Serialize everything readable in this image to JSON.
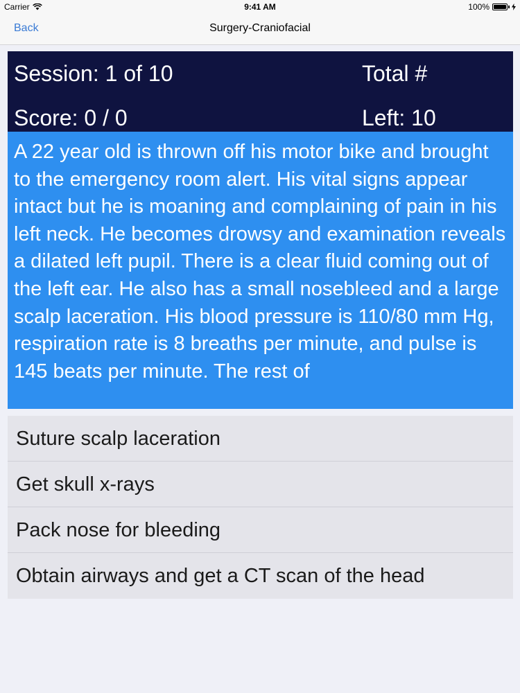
{
  "status_bar": {
    "carrier": "Carrier",
    "time": "9:41 AM",
    "battery": "100%",
    "icons": [
      "wifi-icon",
      "battery-icon",
      "charging-bolt-icon"
    ]
  },
  "nav": {
    "back_label": "Back",
    "title": "Surgery-Craniofacial"
  },
  "session": {
    "session_label": "Session: 1 of 10",
    "total_label": "Total #",
    "score_label": "Score: 0 / 0",
    "left_label": "Left: 10"
  },
  "question": {
    "text": "A 22 year old is thrown off his motor bike and brought to the emergency room alert. His vital signs appear intact but he is moaning and complaining of pain in his left neck. He becomes drowsy and examination reveals a dilated left pupil. There is a clear fluid coming out of the left ear. He also has a small nosebleed and a large scalp laceration. His blood pressure is 110/80 mm Hg, respiration rate is 8 breaths per minute, and pulse is 145 beats per minute. The rest of"
  },
  "answers": [
    {
      "label": "Suture scalp laceration"
    },
    {
      "label": "Get skull x-rays"
    },
    {
      "label": "Pack nose for bleeding"
    },
    {
      "label": "Obtain airways and get a CT scan of the head"
    }
  ],
  "colors": {
    "header_bg": "#0f1340",
    "question_bg": "#2e8ff0",
    "answer_bg": "#e4e4ea",
    "accent": "#3a7bd5",
    "page_bg": "#eff0f7"
  }
}
